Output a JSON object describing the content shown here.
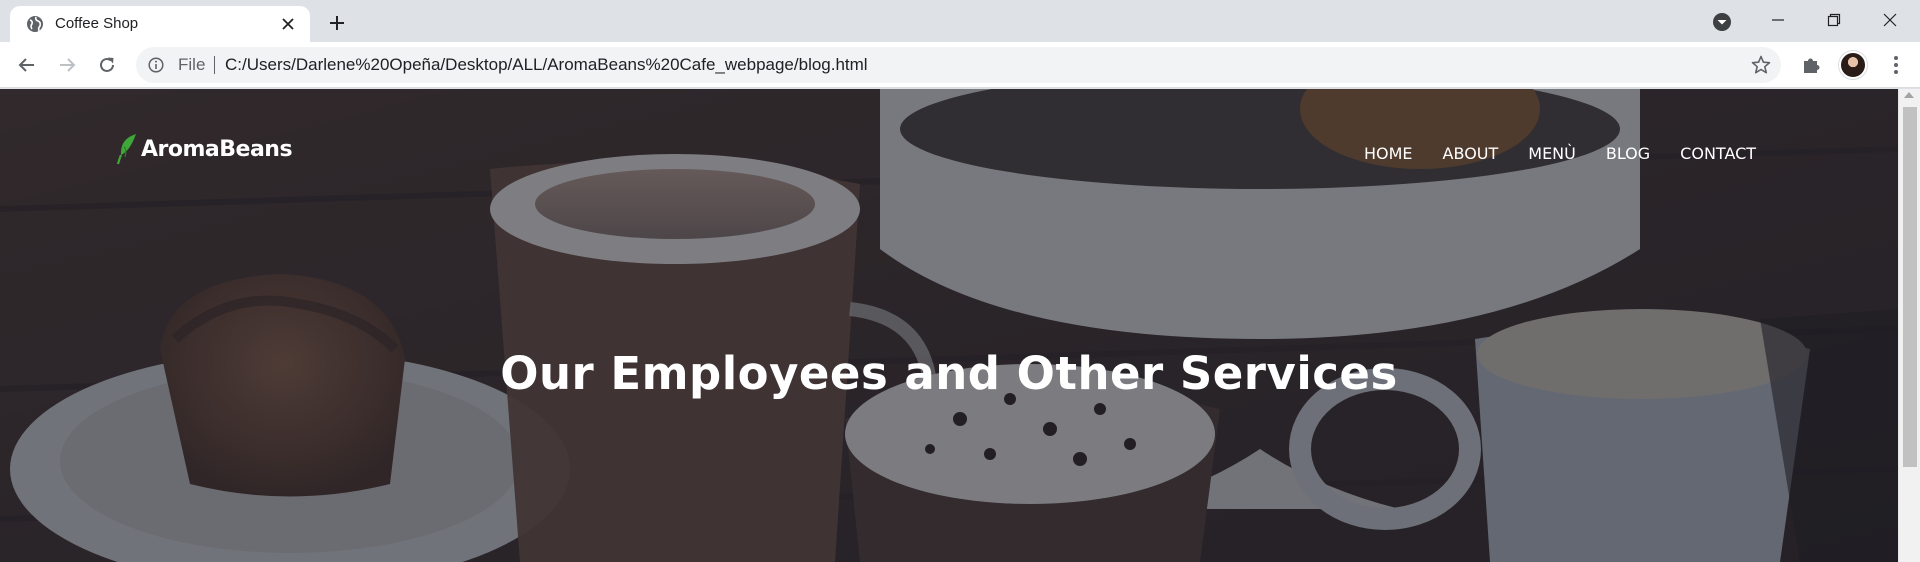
{
  "browser": {
    "tab_title": "Coffee Shop",
    "scheme_label": "File",
    "url": "C:/Users/Darlene%20Opeña/Desktop/ALL/AromaBeans%20Cafe_webpage/blog.html",
    "icons": {
      "favicon": "globe-icon",
      "tab_close": "close-icon",
      "new_tab": "plus-icon",
      "tab_search": "chevron-down-circle-icon",
      "minimize": "minimize-icon",
      "maximize": "restore-icon",
      "close": "close-icon",
      "back": "arrow-left-icon",
      "forward": "arrow-right-icon",
      "reload": "reload-icon",
      "site_info": "info-icon",
      "bookmark": "star-icon",
      "extensions": "puzzle-icon",
      "menu": "kebab-menu-icon"
    }
  },
  "site": {
    "logo_text": "AromaBeans",
    "nav": [
      "HOME",
      "ABOUT",
      "MENÙ",
      "BLOG",
      "CONTACT"
    ],
    "hero_title": "Our Employees and Other Services"
  },
  "colors": {
    "logo_leaf": "#3fa63a",
    "hero_overlay": "#1e2232"
  }
}
